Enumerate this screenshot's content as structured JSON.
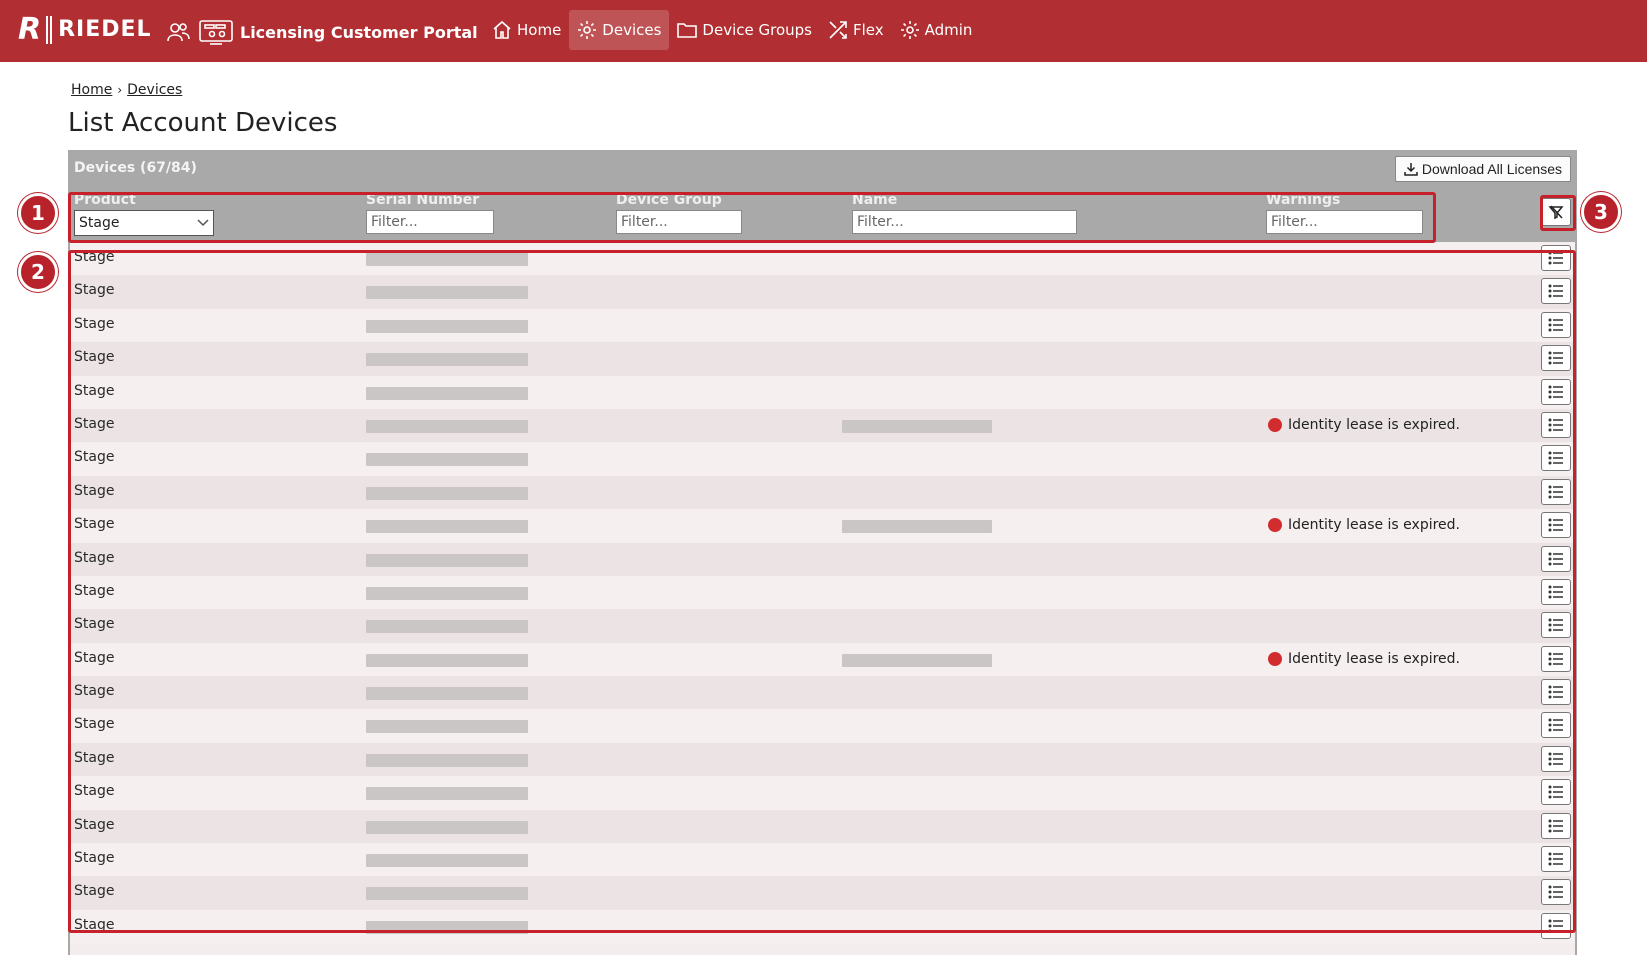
{
  "header": {
    "brand": "RIEDEL",
    "portal_title": "Licensing Customer Portal",
    "nav": [
      {
        "label": "Home",
        "icon": "home-icon",
        "active": false
      },
      {
        "label": "Devices",
        "icon": "gear-icon",
        "active": true
      },
      {
        "label": "Device Groups",
        "icon": "folder-icon",
        "active": false
      },
      {
        "label": "Flex",
        "icon": "flex-icon",
        "active": false
      },
      {
        "label": "Admin",
        "icon": "gear-icon",
        "active": false
      }
    ]
  },
  "breadcrumb": {
    "home": "Home",
    "separator": "›",
    "current": "Devices"
  },
  "page_title": "List Account Devices",
  "table": {
    "count_label": "Devices (67/84)",
    "download_label": "Download All Licenses",
    "columns": {
      "product": "Product",
      "serial": "Serial Number",
      "group": "Device Group",
      "name": "Name",
      "warnings": "Warnings"
    },
    "filters": {
      "product_selected": "Stage",
      "placeholder": "Filter..."
    },
    "rows": [
      {
        "product": "Stage",
        "name": false,
        "warning": ""
      },
      {
        "product": "Stage",
        "name": false,
        "warning": ""
      },
      {
        "product": "Stage",
        "name": false,
        "warning": ""
      },
      {
        "product": "Stage",
        "name": false,
        "warning": ""
      },
      {
        "product": "Stage",
        "name": false,
        "warning": ""
      },
      {
        "product": "Stage",
        "name": true,
        "warning": "Identity lease is expired."
      },
      {
        "product": "Stage",
        "name": false,
        "warning": ""
      },
      {
        "product": "Stage",
        "name": false,
        "warning": ""
      },
      {
        "product": "Stage",
        "name": true,
        "warning": "Identity lease is expired."
      },
      {
        "product": "Stage",
        "name": false,
        "warning": ""
      },
      {
        "product": "Stage",
        "name": false,
        "warning": ""
      },
      {
        "product": "Stage",
        "name": false,
        "warning": ""
      },
      {
        "product": "Stage",
        "name": true,
        "warning": "Identity lease is expired."
      },
      {
        "product": "Stage",
        "name": false,
        "warning": ""
      },
      {
        "product": "Stage",
        "name": false,
        "warning": ""
      },
      {
        "product": "Stage",
        "name": false,
        "warning": ""
      },
      {
        "product": "Stage",
        "name": false,
        "warning": ""
      },
      {
        "product": "Stage",
        "name": false,
        "warning": ""
      },
      {
        "product": "Stage",
        "name": false,
        "warning": ""
      },
      {
        "product": "Stage",
        "name": false,
        "warning": ""
      },
      {
        "product": "Stage",
        "name": false,
        "warning": ""
      }
    ]
  },
  "annotations": {
    "markers": [
      "1",
      "2",
      "3"
    ],
    "color": "#c6202a"
  },
  "colors": {
    "brand": "#b12f33",
    "warning": "#d12d2f"
  }
}
